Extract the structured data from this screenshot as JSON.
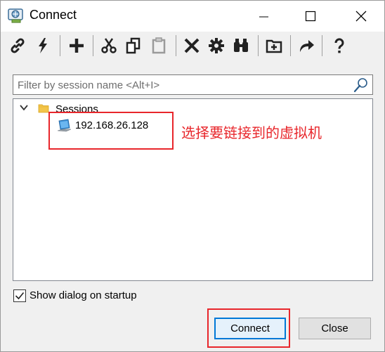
{
  "window": {
    "title": "Connect"
  },
  "toolbar": {
    "tools": [
      {
        "icon": "link-icon"
      },
      {
        "icon": "lightning-icon"
      },
      {
        "icon": "plus-icon"
      },
      {
        "icon": "cut-icon"
      },
      {
        "icon": "copy-icon"
      },
      {
        "icon": "paste-icon"
      },
      {
        "icon": "delete-icon"
      },
      {
        "icon": "gear-icon"
      },
      {
        "icon": "binoculars-icon"
      },
      {
        "icon": "new-folder-icon"
      },
      {
        "icon": "share-arrow-icon"
      },
      {
        "icon": "help-icon"
      }
    ]
  },
  "filter": {
    "placeholder": "Filter by session name <Alt+I>",
    "value": ""
  },
  "tree": {
    "root": {
      "label": "Sessions",
      "expanded": true
    },
    "sessions": [
      {
        "label": "192.168.26.128"
      }
    ]
  },
  "annotation": {
    "text": "选择要链接到的虚拟机",
    "color": "#e8262b"
  },
  "footer": {
    "show_dialog_label": "Show dialog on startup",
    "show_dialog_checked": true,
    "connect_label": "Connect",
    "close_label": "Close"
  }
}
